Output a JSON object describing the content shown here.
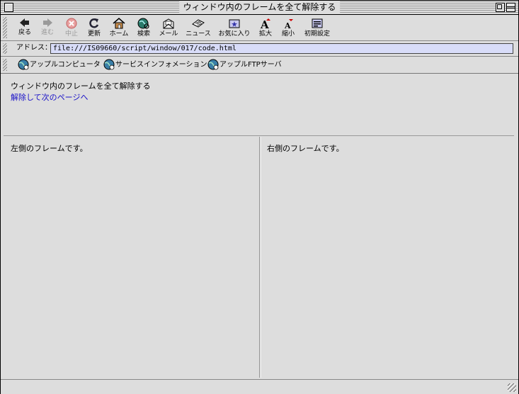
{
  "window": {
    "title": "ウィンドウ内のフレームを全て解除する"
  },
  "toolbar": {
    "buttons": [
      {
        "label": "戻る",
        "icon": "back-arrow-icon",
        "enabled": true
      },
      {
        "label": "進む",
        "icon": "forward-arrow-icon",
        "enabled": false
      },
      {
        "label": "中止",
        "icon": "stop-icon",
        "enabled": false
      },
      {
        "label": "更新",
        "icon": "refresh-icon",
        "enabled": true
      },
      {
        "label": "ホーム",
        "icon": "home-icon",
        "enabled": true
      },
      {
        "label": "検索",
        "icon": "search-globe-icon",
        "enabled": true
      },
      {
        "label": "メール",
        "icon": "mail-icon",
        "enabled": true
      },
      {
        "label": "ニュース",
        "icon": "news-icon",
        "enabled": true
      },
      {
        "label": "お気に入り",
        "icon": "favorites-icon",
        "enabled": true
      },
      {
        "label": "拡大",
        "icon": "font-larger-icon",
        "enabled": true
      },
      {
        "label": "縮小",
        "icon": "font-smaller-icon",
        "enabled": true
      },
      {
        "label": "初期設定",
        "icon": "preferences-icon",
        "enabled": true
      }
    ]
  },
  "address": {
    "label": "アドレス：",
    "value": "file:///IS09660/script/window/017/code.html"
  },
  "favorites": [
    {
      "label": "アップルコンピュータ",
      "icon": "globe-icon"
    },
    {
      "label": "サービスインフォメーション",
      "icon": "globe-icon"
    },
    {
      "label": "アップルFTPサーバ",
      "icon": "globe-icon"
    }
  ],
  "frames": {
    "top": {
      "heading": "ウィンドウ内のフレームを全て解除する",
      "link": "解除して次のページへ"
    },
    "left": {
      "text": "左側のフレームです。"
    },
    "right": {
      "text": "右側のフレームです。"
    }
  },
  "colors": {
    "background": "#dddddd",
    "link": "#1a12c8",
    "address_field": "#d8dcf8"
  }
}
